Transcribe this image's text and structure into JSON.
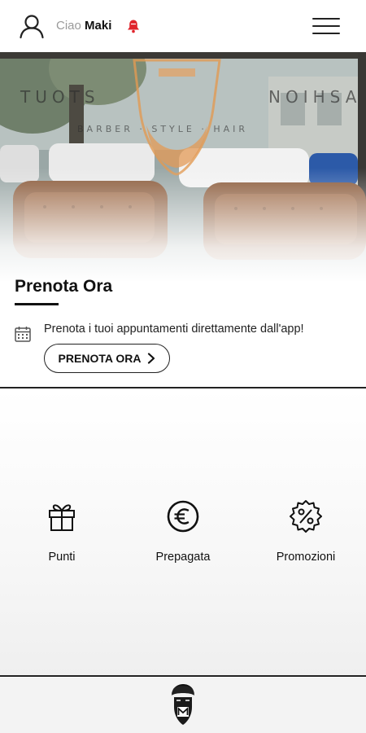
{
  "header": {
    "greeting_prefix": "Ciao",
    "user_name": "Maki"
  },
  "prenota": {
    "title": "Prenota Ora",
    "description": "Prenota i tuoi appuntamenti direttamente dall'app!",
    "button_label": "PRENOTA ORA"
  },
  "quick_actions": {
    "items": [
      {
        "label": "Punti",
        "icon": "gift-icon"
      },
      {
        "label": "Prepagata",
        "icon": "euro-icon"
      },
      {
        "label": "Promozioni",
        "icon": "percent-badge-icon"
      }
    ]
  },
  "colors": {
    "accent_bell": "#e0242c",
    "text": "#111111",
    "muted": "#9a9a9a"
  }
}
